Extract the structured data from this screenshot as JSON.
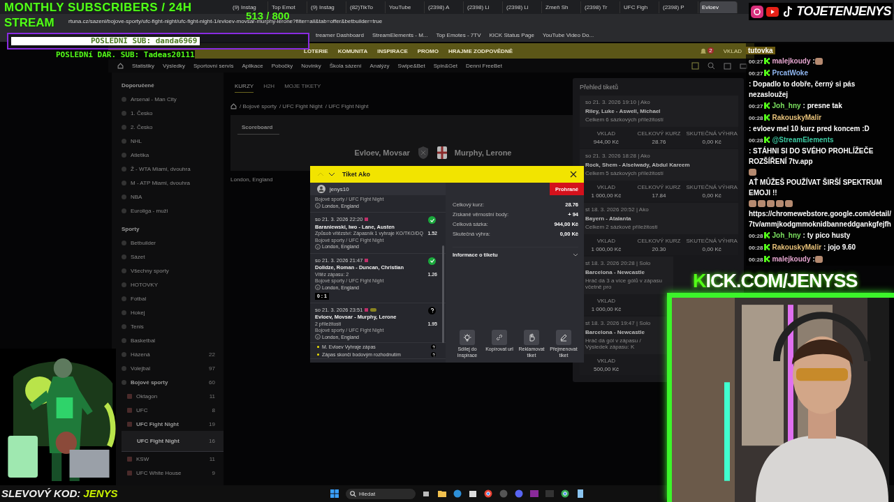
{
  "stream_overlay": {
    "goal_title": "MONTHLY SUBSCRIBERS / 24H",
    "goal_title_2": "STREAM",
    "goal_count": "513  / 800",
    "last_sub": "POSLEDNÍ SUB: danda6969",
    "last_gift": "POSLEDNí DAR. SUB: Tadeas20111",
    "handle": "TOJETENJENYS",
    "kick_url": "KICK.COM/JENYSS",
    "promo_label": "SLEVOVÝ KOD:",
    "promo_code": "JENYS"
  },
  "browser": {
    "tabs": [
      {
        "title": "(9) Instag",
        "selected": false
      },
      {
        "title": "Top Emot",
        "selected": false
      },
      {
        "title": "(9) Instag",
        "selected": false
      },
      {
        "title": "(82)TikTo",
        "selected": false
      },
      {
        "title": "YouTube",
        "selected": false
      },
      {
        "title": "(2398) A",
        "selected": false
      },
      {
        "title": "(2398) Li",
        "selected": false
      },
      {
        "title": "(2398) Li",
        "selected": false
      },
      {
        "title": "Zmeň Sh",
        "selected": false
      },
      {
        "title": "(2398) Tr",
        "selected": false
      },
      {
        "title": "UFC Figh",
        "selected": false
      },
      {
        "title": "(2398) P",
        "selected": false
      },
      {
        "title": "Evloev",
        "selected": true
      }
    ],
    "url": "rtuna.cz/sazeni/bojove-sporty/ufc-fight-night/ufc-fight-night-1/evloev-movsar-murphy-lerone?filter=all&tab=offer&betbuilder=true",
    "bookmarks": [
      "treamer Dashboard",
      "StreamElements - M...",
      "Top Emotes - 7TV",
      "KICK Status Page",
      "YouTube Video Do..."
    ]
  },
  "site": {
    "nav": [
      "LOTERIE",
      "KOMUNITA",
      "INSPIRACE",
      "PROMO",
      "HRAJME ZODPOVĚDNĚ"
    ],
    "deposit": "VKLAD",
    "notifications": "2",
    "subnav": [
      "Statistiky",
      "Výsledky",
      "Sportovní servis",
      "Aplikace",
      "Pobočky",
      "Novinky",
      "Škola sázení",
      "Analýzy",
      "Swipe&Bet",
      "Spin&Get",
      "Denní FreeBet"
    ],
    "sidebar": [
      {
        "title": "Doporučené",
        "items": [
          {
            "label": "Arsenal - Man City"
          },
          {
            "label": "1. Česko"
          },
          {
            "label": "2. Česko"
          },
          {
            "label": "NHL"
          },
          {
            "label": "Atletika"
          },
          {
            "label": "Ž - WTA Miami, dvouhra"
          },
          {
            "label": "M - ATP Miami, dvouhra"
          },
          {
            "label": "NBA"
          },
          {
            "label": "Euroliga - muži"
          }
        ]
      },
      {
        "title": "Sporty",
        "items": [
          {
            "label": "Betbuilder"
          },
          {
            "label": "Sázet"
          },
          {
            "label": "Všechny sporty"
          },
          {
            "label": "HOTOVKY"
          },
          {
            "label": "Fotbal"
          },
          {
            "label": "Hokej"
          },
          {
            "label": "Tenis"
          },
          {
            "label": "Basketbal"
          },
          {
            "label": "Házená",
            "count": "22"
          },
          {
            "label": "Volejbal",
            "count": "97"
          },
          {
            "label": "Bojové sporty",
            "count": "60",
            "expanded": true,
            "children": [
              {
                "label": "Oktagon",
                "count": "11"
              },
              {
                "label": "UFC",
                "count": "8"
              },
              {
                "label": "UFC Fight Night",
                "count": "19",
                "expanded": true,
                "children": [
                  {
                    "label": "UFC Fight Night",
                    "count": "16",
                    "selected": true
                  }
                ]
              },
              {
                "label": "KSW",
                "count": "11"
              },
              {
                "label": "UFC White House",
                "count": "9"
              }
            ]
          }
        ]
      }
    ],
    "content_tabs": [
      {
        "label": "KURZY",
        "selected": true
      },
      {
        "label": "H2H",
        "selected": false
      },
      {
        "label": "MOJE TIKETY",
        "selected": false
      }
    ],
    "breadcrumb": [
      "/ Bojové sporty",
      "/ UFC Fight Night",
      "/ UFC Fight Night"
    ],
    "scoreboard_tab": "Scoreboard",
    "home": "Evloev, Movsar",
    "away": "Murphy, Lerone",
    "venue": "London, England"
  },
  "ticket_overview": {
    "title": "Přehled tiketů",
    "tickets": [
      {
        "date": "so 21. 3. 2026 19:10 | Ako",
        "match": "Riley, Luke - Aswell, Michael",
        "summary": "Celkem 6 sázkových příležitostí",
        "stats": [
          {
            "label": "VKLAD",
            "value": "944,00 Kč"
          },
          {
            "label": "CELKOVÝ KURZ",
            "value": "28.76"
          },
          {
            "label": "SKUTEČNÁ VÝHRA",
            "value": "0,00 Kč"
          }
        ]
      },
      {
        "date": "so 21. 3. 2026 18:28 | Ako",
        "match": "Rock, Shem - Alselwady, Abdul Kareem",
        "summary": "Celkem 5 sázkových příležitostí",
        "stats": [
          {
            "label": "VKLAD",
            "value": "1 000,00 Kč"
          },
          {
            "label": "CELKOVÝ KURZ",
            "value": "17.84"
          },
          {
            "label": "SKUTEČNÁ VÝHRA",
            "value": "0,00 Kč"
          }
        ]
      },
      {
        "date": "st 18. 3. 2026 20:52 | Ako",
        "match": "Bayern - Atalanta",
        "summary": "Celkem 2 sázkové příležitosti",
        "stats": [
          {
            "label": "VKLAD",
            "value": "1 000,00 Kč"
          },
          {
            "label": "CELKOVÝ KURZ",
            "value": "20.30"
          },
          {
            "label": "SKUTEČNÁ VÝHRA",
            "value": "0,00 Kč"
          }
        ]
      },
      {
        "date": "st 18. 3. 2026 20:28 | Solo",
        "match": "Barcelona - Newcastle",
        "summary": "Hráč dá 3 a více gólů v zápasu včetně pro",
        "stats": [
          {
            "label": "VKLAD",
            "value": "1 000,00 Kč"
          }
        ]
      },
      {
        "date": "st 18. 3. 2026 19:47 | Solo",
        "match": "Barcelona - Newcastle",
        "summary": "Hráč dá gól v zápasu / Výsledek zápasu: K",
        "stats": [
          {
            "label": "VKLAD",
            "value": "500,00 Kč"
          }
        ]
      }
    ]
  },
  "ticket_modal": {
    "title": "Tiket Ako",
    "user": "jenys10",
    "status": "Prohrané",
    "selections": [
      {
        "category": "Bojové sporty / UFC Fight Night",
        "location": "London, England"
      },
      {
        "date": "so 21. 3. 2026 22:20",
        "match": "Baraniewski, Iwo - Lane, Austen",
        "market": "Způsob vítězství: Zápasník 1 vyhraje KO/TKO/DQ",
        "odds": "1.52",
        "category": "Bojové sporty / UFC Fight Night",
        "location": "London, England",
        "won": true
      },
      {
        "date": "so 21. 3. 2026 21:47",
        "match": "Dolidze, Roman - Duncan, Christian",
        "market": "Vítěz zápasu: 2",
        "odds": "1.26",
        "category": "Bojové sporty / UFC Fight Night",
        "location": "London, England",
        "won": true,
        "score": "0 : 1"
      },
      {
        "date": "so 21. 3. 2026 23:51",
        "match": "Evloev, Movsar - Murphy, Lerone",
        "market": "2 příležitosti",
        "odds": "1.95",
        "category": "Bojové sporty / UFC Fight Night",
        "location": "London, England",
        "won": false,
        "betbuilder": true,
        "legs": [
          {
            "label": "M. Evloev Vyhraje zápas",
            "won": false
          },
          {
            "label": "Zápas skončí bodovým rozhodnutím",
            "won": false
          }
        ]
      }
    ],
    "summary": [
      {
        "label": "Celkový kurz:",
        "value": "28.76"
      },
      {
        "label": "Získané věrnostní body:",
        "value": "+ 94"
      },
      {
        "label": "Celková sázka:",
        "value": "944,00 Kč"
      },
      {
        "label": "Skutečná výhra:",
        "value": "0,00 Kč"
      }
    ],
    "info": "Informace o tiketu",
    "actions": [
      {
        "kind": "share",
        "label": "Sdílej do Inspirace"
      },
      {
        "kind": "link",
        "label": "Kopírovat url"
      },
      {
        "kind": "claim",
        "label": "Reklamovat tiket"
      },
      {
        "kind": "rename",
        "label": "Přejmenovat tiket"
      }
    ]
  },
  "chat": {
    "header": "tutovka",
    "messages": [
      {
        "time": "00:27",
        "user": "malejkoudy",
        "color": "#e6a6d0",
        "parts": [
          {
            "kind": "text",
            "text": ":"
          },
          {
            "kind": "emote"
          }
        ]
      },
      {
        "time": "00:27",
        "user": "PrcatWoke",
        "color": "#8fb6f0",
        "parts": [
          {
            "kind": "text",
            "text": ": Dopadlo to dobře, černý si pás nezasloužej"
          }
        ]
      },
      {
        "time": "00:27",
        "user": "Joh_hny",
        "color": "#7be05f",
        "parts": [
          {
            "kind": "text",
            "text": ": presne tak"
          }
        ]
      },
      {
        "time": "00:28",
        "user": "RakouskyMalir",
        "color": "#e8c27a",
        "parts": [
          {
            "kind": "text",
            "text": ": evloev mel 10 kurz pred koncem :D"
          }
        ]
      },
      {
        "time": "00:28",
        "user": "@StreamElements",
        "color": "#3cc9a2",
        "parts": [
          {
            "kind": "text",
            "text": ": STÁHNI SI DO SVÉHO PROHLÍŽEČE ROZŠÍŘENÍ 7tv.app"
          },
          {
            "kind": "emote"
          },
          {
            "kind": "text",
            "text": "AŤ MŮŽEŠ POUŽÍVAT ŠIRŠÍ SPEKTRUM EMOJI !!"
          },
          {
            "kind": "emote"
          },
          {
            "kind": "emote"
          },
          {
            "kind": "emote"
          },
          {
            "kind": "emote"
          },
          {
            "kind": "emote"
          },
          {
            "kind": "link",
            "text": "https://chromewebstore.google.com/detail/7tv/ammjkodgmmoknidbanneddgankgfejfh"
          }
        ]
      },
      {
        "time": "00:28",
        "user": "Joh_hny",
        "color": "#7be05f",
        "parts": [
          {
            "kind": "text",
            "text": ": ty pico husty"
          }
        ]
      },
      {
        "time": "00:28",
        "user": "RakouskyMalir",
        "color": "#e8c27a",
        "parts": [
          {
            "kind": "text",
            "text": ": jojo 9.60"
          }
        ]
      },
      {
        "time": "00:28",
        "user": "malejkoudy",
        "color": "#e6a6d0",
        "parts": [
          {
            "kind": "text",
            "text": ":"
          },
          {
            "kind": "emote"
          }
        ]
      }
    ]
  },
  "taskbar": {
    "search": "Hledat"
  }
}
